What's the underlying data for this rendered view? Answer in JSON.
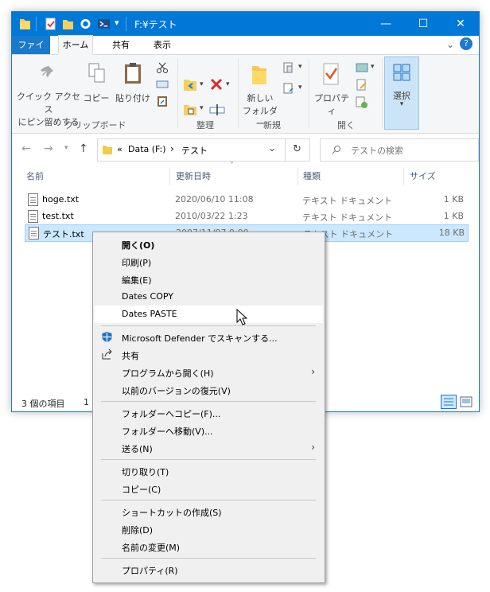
{
  "window": {
    "title": "F:¥テスト",
    "min_label": "—",
    "max_label": "☐",
    "close_label": "✕"
  },
  "quick_access": {
    "dropdown": "▾"
  },
  "ribbon_tabs": [
    {
      "label": "ファイル"
    },
    {
      "label": "ホーム"
    },
    {
      "label": "共有"
    },
    {
      "label": "表示"
    }
  ],
  "ribbon": {
    "pin_line1": "クイック アクセス",
    "pin_line2": "にピン留めする",
    "copy": "コピー",
    "paste": "貼り付け",
    "group_clipboard": "クリップボード",
    "group_organize": "整理",
    "new_folder_line1": "新しい",
    "new_folder_line2": "フォルダー",
    "group_new": "新規",
    "properties": "プロパティ",
    "group_open": "開く",
    "select": "選択",
    "help": "?"
  },
  "address": {
    "prefix": "«",
    "segment1": "Data (F:)",
    "chevron": "›",
    "segment2": "テスト",
    "dropdown": "⌄",
    "refresh": "↻"
  },
  "search": {
    "placeholder": "テストの検索"
  },
  "columns": {
    "name": "名前",
    "modified": "更新日時",
    "type": "種類",
    "size": "サイズ",
    "sort_indicator": "˅"
  },
  "files": [
    {
      "name": "hoge.txt",
      "modified": "2020/06/10 11:08",
      "type": "テキスト ドキュメント",
      "size": "1 KB"
    },
    {
      "name": "test.txt",
      "modified": "2010/03/22 1:23",
      "type": "テキスト ドキュメント",
      "size": "1 KB"
    },
    {
      "name": "テスト.txt",
      "modified": "2007/11/07 0:00",
      "type": "テキスト ドキュメント",
      "size": "18 KB"
    }
  ],
  "status": {
    "items": "3 個の項目",
    "selected": "1"
  },
  "context_menu": {
    "open": "開く(O)",
    "print": "印刷(P)",
    "edit": "編集(E)",
    "dates_copy": "Dates COPY",
    "dates_paste": "Dates PASTE",
    "defender": "Microsoft Defender でスキャンする...",
    "share": "共有",
    "open_with": "プログラムから開く(H)",
    "restore": "以前のバージョンの復元(V)",
    "copy_to": "フォルダーへコピー(F)...",
    "move_to": "フォルダーへ移動(V)...",
    "send_to": "送る(N)",
    "cut": "切り取り(T)",
    "copy": "コピー(C)",
    "shortcut": "ショートカットの作成(S)",
    "delete": "削除(D)",
    "rename": "名前の変更(M)",
    "properties": "プロパティ(R)",
    "submenu_arrow": "›"
  },
  "colors": {
    "titlebar": "#0078d7",
    "selection": "#cce8ff",
    "selection_border": "#99d1ff"
  }
}
